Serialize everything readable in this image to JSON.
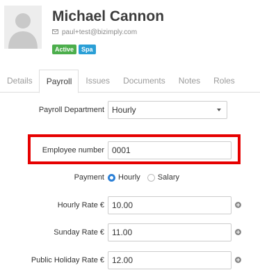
{
  "profile": {
    "name": "Michael Cannon",
    "email": "paul+test@bizimply.com",
    "badges": {
      "active": "Active",
      "spa": "Spa"
    },
    "colors": {
      "active": "#4cae4c",
      "spa": "#2a9fd6",
      "highlight": "#e60000"
    }
  },
  "tabs": [
    "Details",
    "Payroll",
    "Issues",
    "Documents",
    "Notes",
    "Roles"
  ],
  "active_tab": "Payroll",
  "form": {
    "payroll_department": {
      "label": "Payroll Department",
      "value": "Hourly"
    },
    "employee_number": {
      "label": "Employee number",
      "value": "0001"
    },
    "payment": {
      "label": "Payment",
      "options": [
        "Hourly",
        "Salary"
      ],
      "selected": "Hourly"
    },
    "hourly_rate": {
      "label": "Hourly Rate €",
      "value": "10.00"
    },
    "sunday_rate": {
      "label": "Sunday Rate €",
      "value": "11.00"
    },
    "public_holiday_rate": {
      "label": "Public Holiday Rate €",
      "value": "12.00"
    }
  }
}
